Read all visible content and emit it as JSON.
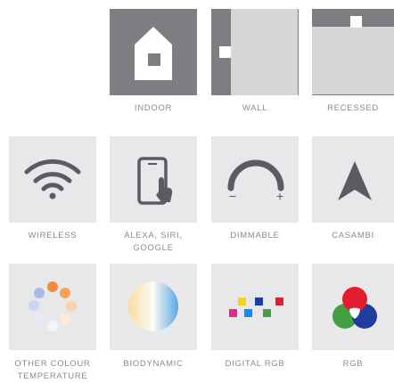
{
  "mounting": {
    "items": [
      {
        "label": "INDOOR",
        "icon": "house-icon"
      },
      {
        "label": "WALL",
        "icon": "wall-mount-icon"
      },
      {
        "label": "RECESSED",
        "icon": "recessed-mount-icon"
      }
    ]
  },
  "features": {
    "row1": [
      {
        "label": "WIRELESS",
        "icon": "wifi-icon"
      },
      {
        "label": "ALEXA, SIRI, GOOGLE",
        "icon": "phone-touch-icon"
      },
      {
        "label": "DIMMABLE",
        "icon": "dimmer-dial-icon",
        "minus": "−",
        "plus": "+"
      },
      {
        "label": "CASAMBI",
        "icon": "casambi-logo-icon"
      }
    ],
    "row2": [
      {
        "label": "OTHER COLOUR TEMPERATURE",
        "icon": "colour-dots-icon"
      },
      {
        "label": "BIODYNAMIC",
        "icon": "biodynamic-gradient-icon"
      },
      {
        "label": "DIGITAL RGB",
        "icon": "digital-rgb-pixels-icon"
      },
      {
        "label": "RGB",
        "icon": "rgb-circles-icon"
      }
    ]
  },
  "colors": {
    "tile_gray": "#e8e8ea",
    "tile_dark": "#7d7e82",
    "icon_dark": "#5b5c63",
    "label_text": "#8a8a8a",
    "red": "#e31d2d",
    "green": "#43a047",
    "blue": "#1f3c9e"
  }
}
